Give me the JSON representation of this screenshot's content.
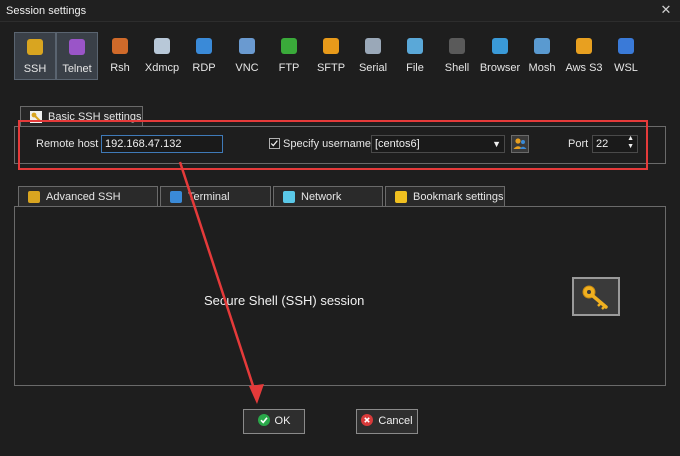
{
  "window": {
    "title": "Session settings",
    "close_glyph": "✕"
  },
  "session_types": [
    {
      "label": "SSH",
      "icon": "ssh-key-icon",
      "color": "#d9a520"
    },
    {
      "label": "Telnet",
      "icon": "telnet-icon",
      "color": "#9a55c8"
    },
    {
      "label": "Rsh",
      "icon": "rsh-icon",
      "color": "#d06a2a"
    },
    {
      "label": "Xdmcp",
      "icon": "xdmcp-icon",
      "color": "#b8c8d8"
    },
    {
      "label": "RDP",
      "icon": "rdp-icon",
      "color": "#3a8ad8"
    },
    {
      "label": "VNC",
      "icon": "vnc-icon",
      "color": "#6a9ad0"
    },
    {
      "label": "FTP",
      "icon": "ftp-icon",
      "color": "#3aaa3a"
    },
    {
      "label": "SFTP",
      "icon": "sftp-icon",
      "color": "#e89a1a"
    },
    {
      "label": "Serial",
      "icon": "serial-icon",
      "color": "#9aa8b8"
    },
    {
      "label": "File",
      "icon": "file-icon",
      "color": "#5aa8d8"
    },
    {
      "label": "Shell",
      "icon": "shell-icon",
      "color": "#5a5a5a"
    },
    {
      "label": "Browser",
      "icon": "browser-icon",
      "color": "#3a9ad8"
    },
    {
      "label": "Mosh",
      "icon": "mosh-icon",
      "color": "#5a9ad0"
    },
    {
      "label": "Aws S3",
      "icon": "aws-s3-icon",
      "color": "#e8a020"
    },
    {
      "label": "WSL",
      "icon": "wsl-icon",
      "color": "#3a7ad8"
    }
  ],
  "basic": {
    "tab_label": "Basic SSH settings",
    "remote_host_label": "Remote host *",
    "remote_host_value": "192.168.47.132",
    "specify_username_label": "Specify username",
    "specify_username_checked": true,
    "username_value": "[centos6]",
    "port_label": "Port",
    "port_value": "22"
  },
  "lower_tabs": [
    {
      "label": "Advanced SSH settings",
      "icon": "key-icon"
    },
    {
      "label": "Terminal settings",
      "icon": "terminal-icon"
    },
    {
      "label": "Network settings",
      "icon": "network-icon"
    },
    {
      "label": "Bookmark settings",
      "icon": "star-icon"
    }
  ],
  "session_description": "Secure Shell (SSH) session",
  "buttons": {
    "ok": "OK",
    "cancel": "Cancel"
  },
  "colors": {
    "highlight": "#e53a3a",
    "ok_green": "#2aa84a",
    "cancel_red": "#d83a3a"
  }
}
